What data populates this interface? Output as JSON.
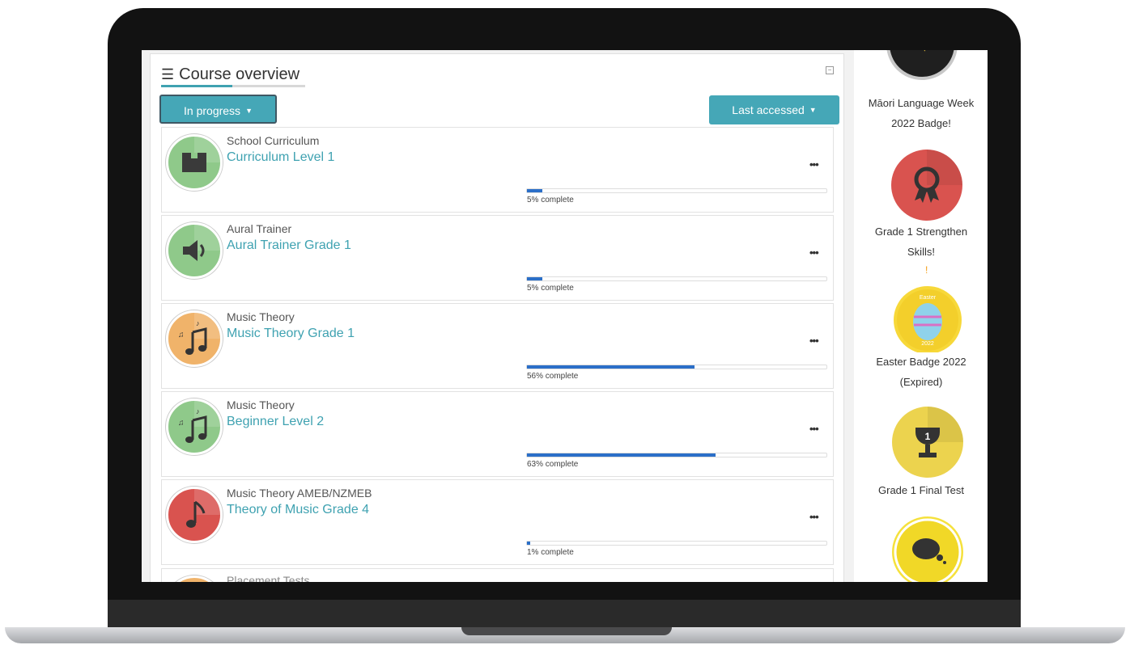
{
  "block": {
    "title": "Course overview",
    "filter_label": "In progress",
    "sort_label": "Last accessed"
  },
  "courses": [
    {
      "category": "School Curriculum",
      "name": "Curriculum Level 1",
      "progress": 5,
      "progress_text": "5% complete",
      "icon": "building-icon",
      "color": "#8fc98a"
    },
    {
      "category": "Aural Trainer",
      "name": "Aural Trainer Grade 1",
      "progress": 5,
      "progress_text": "5% complete",
      "icon": "speaker-icon",
      "color": "#8fc98a"
    },
    {
      "category": "Music Theory",
      "name": "Music Theory Grade 1",
      "progress": 56,
      "progress_text": "56% complete",
      "icon": "music-notes-icon",
      "color": "#f0b36a"
    },
    {
      "category": "Music Theory",
      "name": "Beginner Level 2",
      "progress": 63,
      "progress_text": "63% complete",
      "icon": "music-notes-icon",
      "color": "#8fc98a"
    },
    {
      "category": "Music Theory AMEB/NZMEB",
      "name": "Theory of Music Grade 4",
      "progress": 1,
      "progress_text": "1% complete",
      "icon": "music-note-icon",
      "color": "#d9534f"
    },
    {
      "category": "Placement Tests"
    }
  ],
  "badges": [
    {
      "label": "Māori Language Week 2022 Badge!",
      "icon": "stars-badge-icon",
      "color": "#1f1f1f"
    },
    {
      "label": "Grade 1 Strengthen Skills!",
      "icon": "rosette-icon",
      "color": "#d9534f"
    },
    {
      "label": "Easter Badge 2022 (Expired)",
      "icon": "easter-egg-icon",
      "color": "#f7d839",
      "badge_text_top": "Easter",
      "badge_text_bottom": "2022"
    },
    {
      "label": "Grade 1 Final Test",
      "icon": "trophy-icon",
      "color": "#ecd34e",
      "badge_text": "1"
    },
    {
      "label": "",
      "icon": "speech-bubble-icon",
      "color": "#f5e13c"
    }
  ],
  "icons": {
    "menu": "hamburger-icon",
    "more": "more-dots-icon",
    "collapse": "collapse-icon",
    "caret": "caret-down-icon"
  }
}
